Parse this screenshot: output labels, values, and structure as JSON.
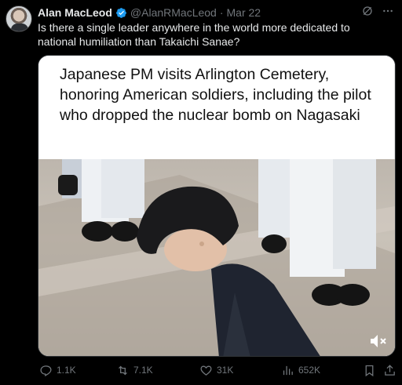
{
  "tweet": {
    "author_name": "Alan MacLeod",
    "handle": "@AlanRMacLeod",
    "separator": "·",
    "date": "Mar 22",
    "text": "Is there a single leader anywhere in the world more dedicated to national humiliation than Takaichi Sanae?"
  },
  "media": {
    "caption": "Japanese PM visits Arlington Cemetery, honoring American soldiers, including the pilot who dropped the nuclear bomb on Nagasaki"
  },
  "actions": {
    "replies": "1.1K",
    "reposts": "7.1K",
    "likes": "31K",
    "views": "652K"
  },
  "colors": {
    "background": "#000000",
    "text": "#e7e9ea",
    "muted": "#71767b",
    "verified": "#1d9bf0"
  }
}
